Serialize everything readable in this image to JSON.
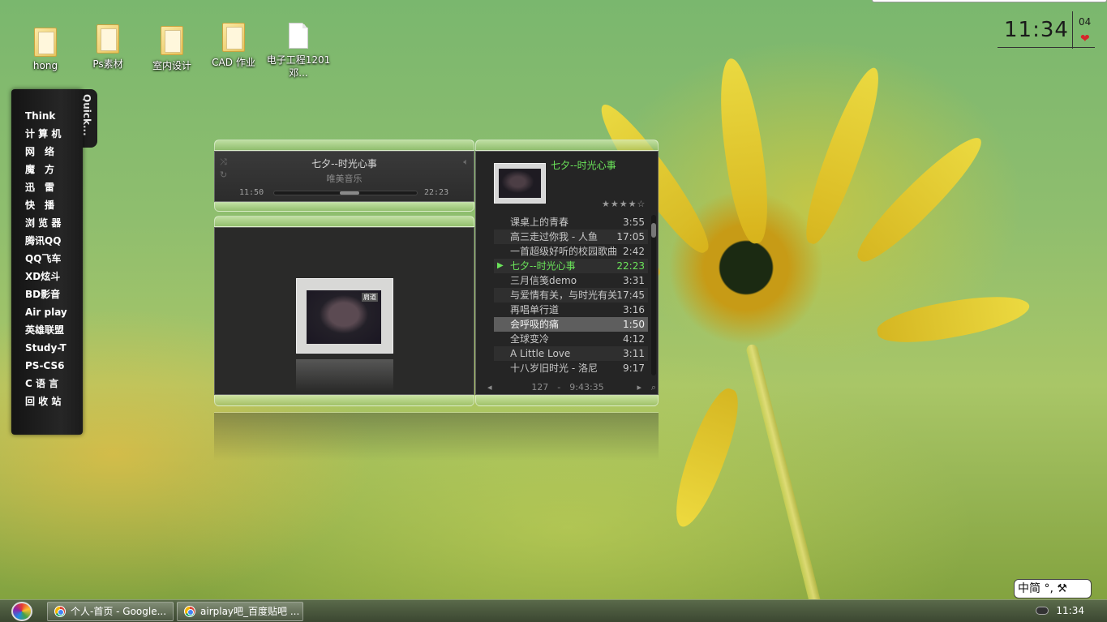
{
  "desktop": {
    "icons": [
      {
        "label": "hong",
        "type": "folder"
      },
      {
        "label": "Ps素材",
        "type": "folder"
      },
      {
        "label": "室内设计",
        "type": "folder"
      },
      {
        "label": "CAD 作业",
        "type": "folder"
      },
      {
        "label": "电子工程1201　邓...",
        "type": "document"
      }
    ]
  },
  "clock": {
    "time": "11:34",
    "day": "04",
    "heart": "❤"
  },
  "quick_launch": {
    "tab_label": "Quick...",
    "items": [
      "Think",
      "计 算 机",
      "网　络",
      "魔　方",
      "迅　雷",
      "快　播",
      "浏 览 器",
      "腾讯QQ",
      "QQ飞车",
      "XD炫斗",
      "BD影音",
      "Air play",
      "英雄联盟",
      "Study-T",
      "PS-CS6",
      "C 语 言",
      "回 收 站"
    ]
  },
  "player": {
    "now_playing": {
      "title": "七夕--时光心事",
      "artist": "唯美音乐",
      "elapsed": "11:50",
      "total": "22:23",
      "progress": 0.53
    },
    "album_label": "肩道",
    "playlist": {
      "current_title": "七夕--时光心事",
      "rating": 4,
      "stars": "★★★★☆",
      "tracks": [
        {
          "name": "课桌上的青春",
          "duration": "3:55"
        },
        {
          "name": "高三走过你我 - 人鱼",
          "duration": "17:05"
        },
        {
          "name": "一首超级好听的校园歌曲",
          "duration": "2:42"
        },
        {
          "name": "七夕--时光心事",
          "duration": "22:23",
          "playing": true
        },
        {
          "name": "三月信笺demo",
          "duration": "3:31"
        },
        {
          "name": "与爱情有关，与时光有关",
          "duration": "17:45"
        },
        {
          "name": "再唱单行道",
          "duration": "3:16"
        },
        {
          "name": "会呼吸的痛",
          "duration": "1:50",
          "selected": true
        },
        {
          "name": "全球变冷",
          "duration": "4:12"
        },
        {
          "name": "A Little Love",
          "duration": "3:11"
        },
        {
          "name": "十八岁旧时光 - 洛尼",
          "duration": "9:17"
        }
      ],
      "footer": "127　-　9:43:35"
    }
  },
  "taskbar": {
    "tasks": [
      {
        "label": "个人-首页 - Google..."
      },
      {
        "label": "airplay吧_百度贴吧 ..."
      }
    ],
    "time": "11:34"
  },
  "ime": {
    "label": "中简 °, ⚒"
  },
  "colors": {
    "accent_green": "#6be55a",
    "heart": "#d8262b"
  }
}
